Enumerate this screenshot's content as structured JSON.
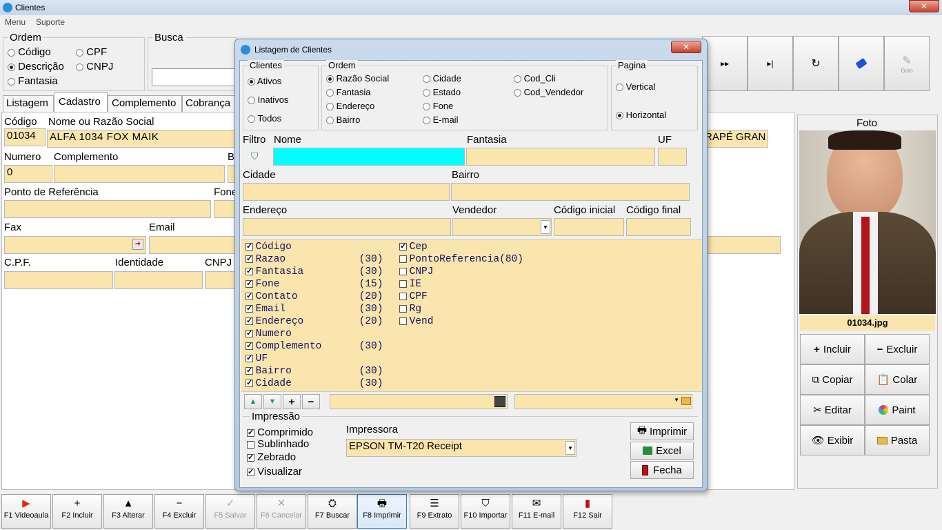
{
  "window": {
    "title": "Clientes",
    "close": "✕"
  },
  "menu": [
    "Menu",
    "Suporte"
  ],
  "ordem": {
    "title": "Ordem",
    "options": [
      "Código",
      "CPF",
      "Descrição",
      "CNPJ",
      "Fantasia"
    ],
    "selected": "Descrição"
  },
  "busca": {
    "label": "Busca",
    "value": ""
  },
  "tabs": [
    "Listagem",
    "Cadastro",
    "Complemento",
    "Cobrança"
  ],
  "form": {
    "codigo_label": "Código",
    "codigo": "01034",
    "nome_label": "Nome ou Razão Social",
    "nome": "ALFA 1034 FOX MAIK",
    "right_partial": "RAPÉ GRAN",
    "numero_label": "Numero",
    "numero": "0",
    "complemento_label": "Complemento",
    "b_partial": "B",
    "ponto_label": "Ponto de Referência",
    "fone_partial": "Fone",
    "fax_label": "Fax",
    "email_label": "Email",
    "cpf_label": "C.P.F.",
    "identidade_label": "Identidade",
    "cnpj_label": "CNPJ"
  },
  "nav": {
    "next": "▸▸",
    "last": "▸|",
    "refresh": "↻",
    "goto": "Goto"
  },
  "foto": {
    "title": "Foto",
    "filename": "01034.jpg",
    "buttons": [
      "Incluir",
      "Excluir",
      "Copiar",
      "Colar",
      "Editar",
      "Paint",
      "Exibir",
      "Pasta"
    ]
  },
  "fkeys": [
    "F1 Videoaula",
    "F2 Incluir",
    "F3 Alterar",
    "F4 Excluir",
    "F5 Salvar",
    "F6 Cancelar",
    "F7 Buscar",
    "F8 Imprimir",
    "F9 Extrato",
    "F10 Importar",
    "F11 E-mail",
    "F12 Sair"
  ],
  "dialog": {
    "title": "Listagem de Clientes",
    "close": "✕",
    "clientes": {
      "title": "Clientes",
      "options": [
        "Ativos",
        "Inativos",
        "Todos"
      ],
      "selected": "Ativos"
    },
    "ordem": {
      "title": "Ordem",
      "options": [
        "Razão Social",
        "Cidade",
        "Cod_Cli",
        "Fantasia",
        "Estado",
        "Cod_Vendedor",
        "Endereço",
        "Fone",
        "Bairro",
        "E-mail"
      ],
      "selected": "Razão Social"
    },
    "pagina": {
      "title": "Pagina",
      "options": [
        "Vertical",
        "Horizontal"
      ],
      "selected": "Horizontal"
    },
    "filtro": {
      "label": "Filtro",
      "nome": "Nome",
      "fantasia": "Fantasia",
      "uf": "UF",
      "cidade": "Cidade",
      "bairro": "Bairro",
      "endereco": "Endereço",
      "vendedor": "Vendedor",
      "cod_ini": "Código inicial",
      "cod_fim": "Código final"
    },
    "fields_left": [
      [
        "Código",
        ""
      ],
      [
        "Razao",
        "(30)"
      ],
      [
        "Fantasia",
        "(30)"
      ],
      [
        "Fone",
        "(15)"
      ],
      [
        "Contato",
        "(20)"
      ],
      [
        "Email",
        "(30)"
      ],
      [
        "Endereço",
        "(20)"
      ],
      [
        "Numero",
        ""
      ],
      [
        "Complemento",
        "(30)"
      ],
      [
        "UF",
        ""
      ],
      [
        "Bairro",
        "(30)"
      ],
      [
        "Cidade",
        "(30)"
      ]
    ],
    "fields_right": [
      [
        "Cep",
        true
      ],
      [
        "PontoReferencia(80)",
        false
      ],
      [
        "CNPJ",
        false
      ],
      [
        "IE",
        false
      ],
      [
        "CPF",
        false
      ],
      [
        "Rg",
        false
      ],
      [
        "Vend",
        false
      ]
    ],
    "impressao": {
      "title": "Impressão",
      "options": [
        [
          "Comprimido",
          true
        ],
        [
          "Sublinhado",
          false
        ],
        [
          "Zebrado",
          true
        ],
        [
          "Visualizar",
          true
        ]
      ]
    },
    "impressora": {
      "label": "Impressora",
      "value": "EPSON TM-T20 Receipt"
    },
    "buttons": [
      "Imprimir",
      "Excel",
      "Fecha"
    ]
  },
  "colors": {
    "accent": "#fbe5ae",
    "highlight": "#00ffff"
  }
}
